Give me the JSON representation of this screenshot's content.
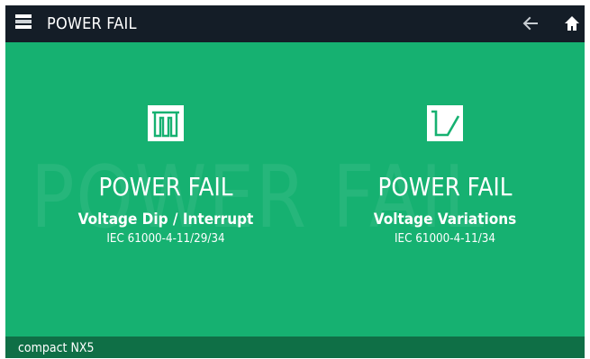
{
  "header": {
    "title": "POWER FAIL",
    "icons": [
      "menu-icon",
      "back-arrow-icon",
      "home-icon"
    ]
  },
  "watermark": "POWER FAIL",
  "panels": [
    {
      "icon": "interrupt-waveform-icon",
      "heading": "POWER FAIL",
      "subtitle": "Voltage Dip / Interrupt",
      "standard": "IEC 61000-4-11/29/34"
    },
    {
      "icon": "voltage-variation-icon",
      "heading": "POWER FAIL",
      "subtitle": "Voltage Variations",
      "standard": "IEC 61000-4-11/34"
    }
  ],
  "footer": {
    "device": "compact NX5"
  },
  "colors": {
    "topbar": "#141d27",
    "main": "#16b171",
    "footer": "#0f6f46",
    "text": "#ffffff"
  }
}
